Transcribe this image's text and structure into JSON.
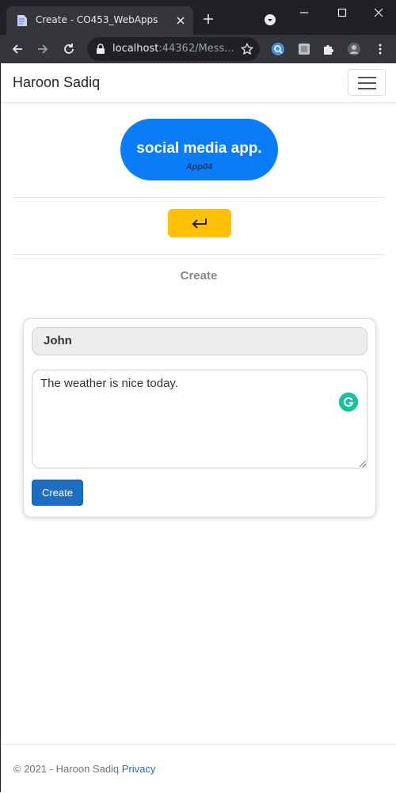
{
  "browser": {
    "tab_title": "Create - CO453_WebApps",
    "url_host": "localhost",
    "url_rest": ":44362/Mess..."
  },
  "navbar": {
    "brand": "Haroon Sadiq"
  },
  "logo": {
    "title": "social media app.",
    "subtitle": "App04"
  },
  "page": {
    "heading": "Create"
  },
  "form": {
    "name_value": "John",
    "message_value": "The weather is nice today.",
    "submit_label": "Create"
  },
  "footer": {
    "copyright": "© 2021 - Haroon Sadiq ",
    "privacy_link": "Privacy"
  },
  "colors": {
    "brand_blue": "#0a7cf7",
    "back_button": "#ffc107",
    "primary_button": "#1b6ec2",
    "grammarly": "#15c39a"
  }
}
